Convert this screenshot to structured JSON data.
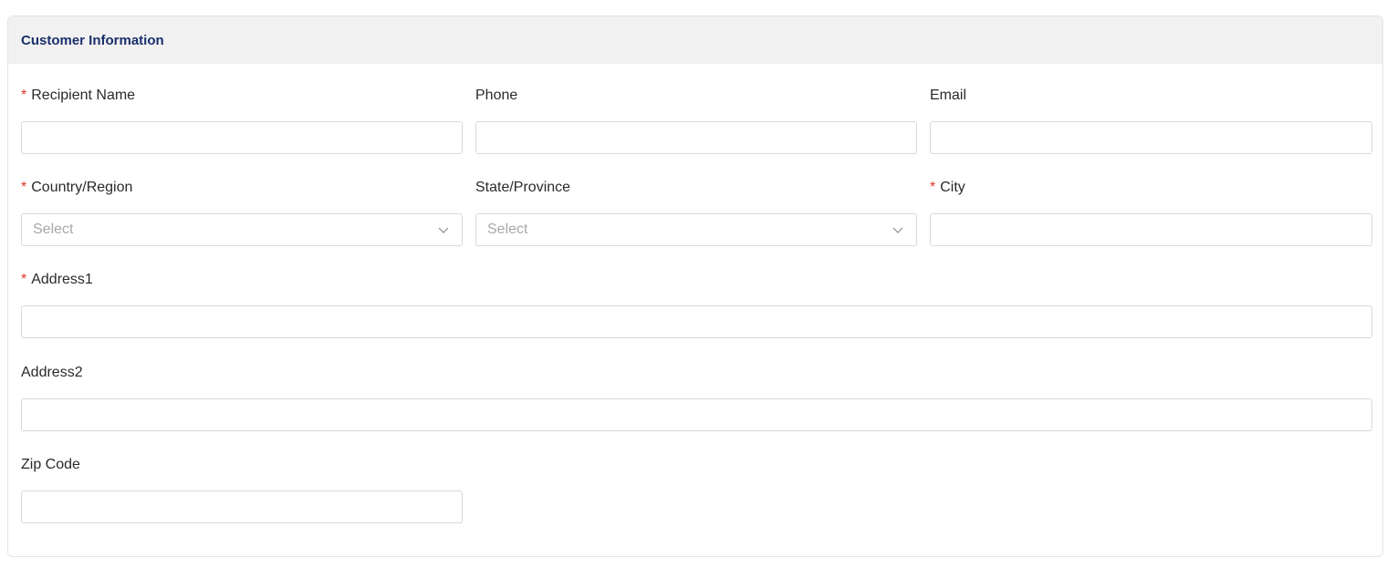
{
  "section": {
    "title": "Customer Information"
  },
  "required_marker": "*",
  "fields": {
    "recipient_name": {
      "label": "Recipient Name",
      "required": true,
      "value": ""
    },
    "phone": {
      "label": "Phone",
      "required": false,
      "value": ""
    },
    "email": {
      "label": "Email",
      "required": false,
      "value": ""
    },
    "country_region": {
      "label": "Country/Region",
      "required": true,
      "placeholder": "Select"
    },
    "state_province": {
      "label": "State/Province",
      "required": false,
      "placeholder": "Select"
    },
    "city": {
      "label": "City",
      "required": true,
      "value": ""
    },
    "address1": {
      "label": "Address1",
      "required": true,
      "value": ""
    },
    "address2": {
      "label": "Address2",
      "required": false,
      "value": ""
    },
    "zip_code": {
      "label": "Zip Code",
      "required": false,
      "value": ""
    }
  },
  "icons": {
    "select_arrow": "chevron-down-icon"
  },
  "colors": {
    "title": "#1b2f6b",
    "required": "#e0362b",
    "header_bg": "#f1f1f1",
    "border": "#d9d9d9",
    "placeholder": "#a8a8a8"
  }
}
